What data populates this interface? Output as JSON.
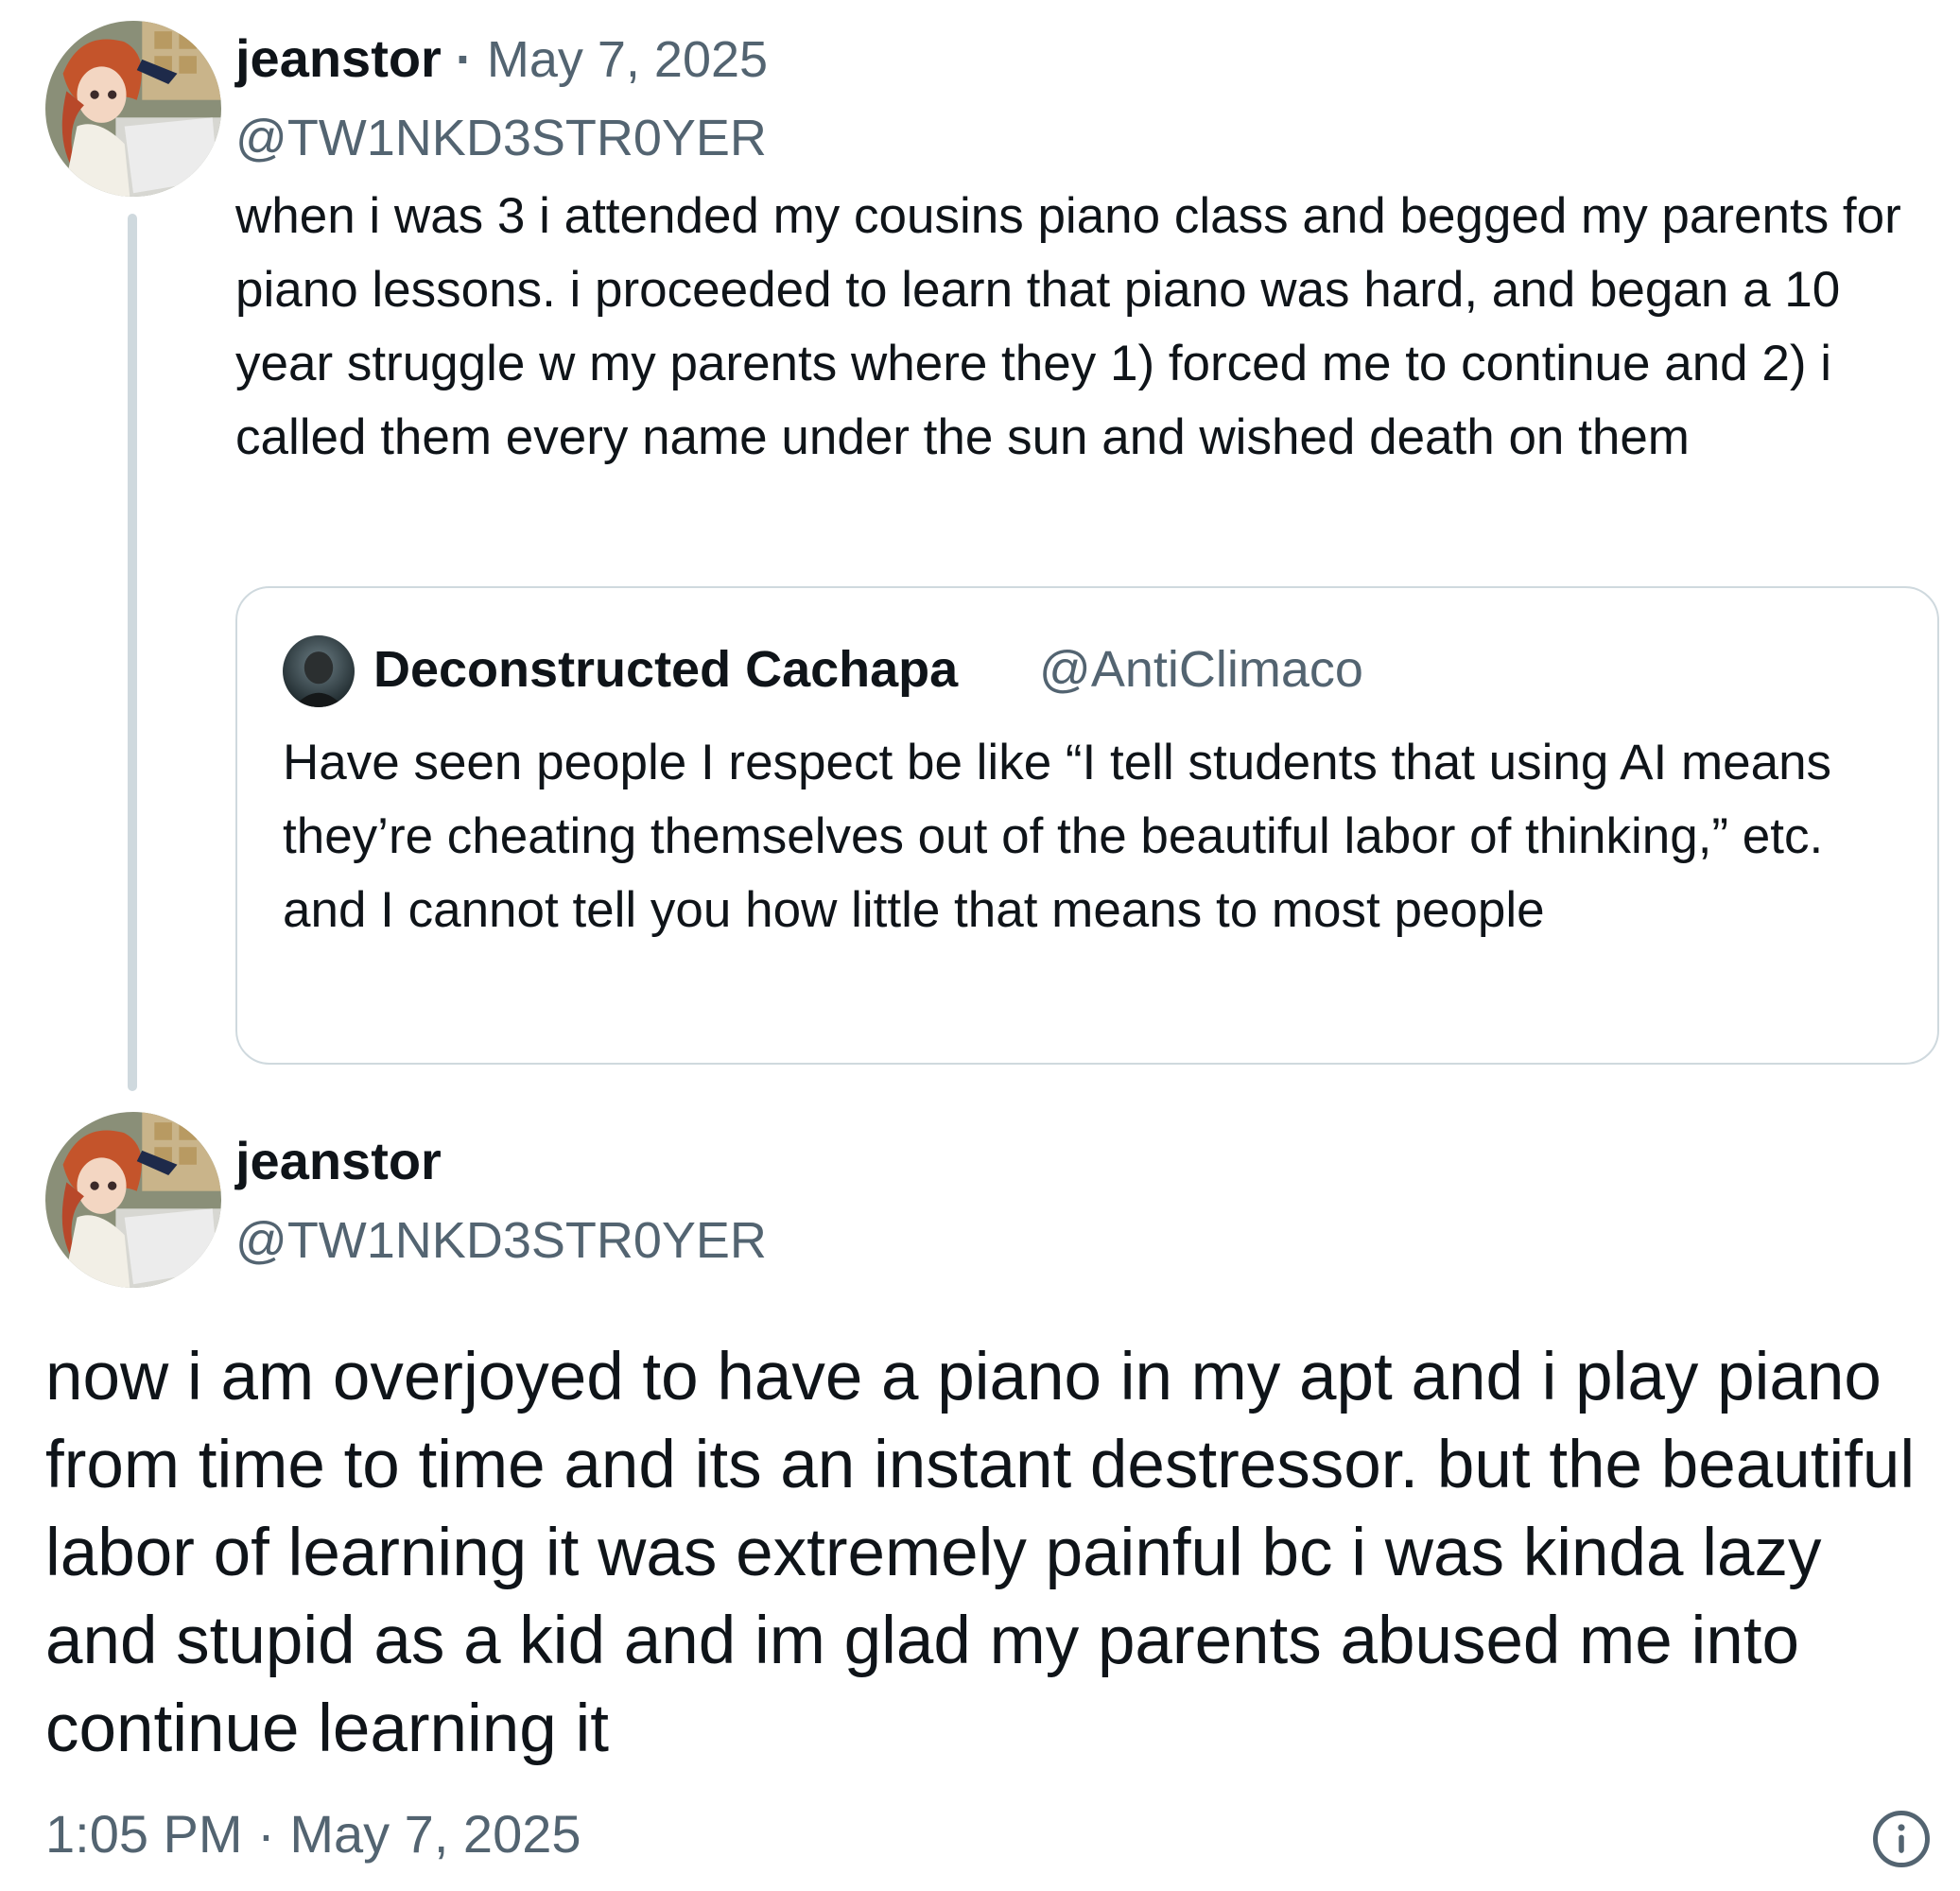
{
  "parent_tweet": {
    "author_name": "jeanstor",
    "date_separator": " · ",
    "date": "May 7, 2025",
    "handle": "@TW1NKD3STR0YER",
    "text": "when i was 3 i attended my cousins piano class and begged my parents for piano lessons. i proceeded to learn that piano was hard, and began a 10 year struggle w my parents where they 1) forced me to continue and 2) i called them every name under the sun and wished death on them",
    "avatar_icon": "anime-character-avatar"
  },
  "quoted_tweet": {
    "author_name": "Deconstructed Cachapa",
    "handle": "@AntiClimaco",
    "text": "Have seen people I respect be like “I tell students that using AI means they’re cheating themselves out of the beautiful labor of thinking,” etc. and I cannot tell you how little that means to most people",
    "avatar_icon": "dark-photo-avatar"
  },
  "main_tweet": {
    "author_name": "jeanstor",
    "handle": "@TW1NKD3STR0YER",
    "text": "now i am overjoyed to have a piano in my apt and i play piano from time to time and its an instant destressor. but the beautiful labor of learning it was extremely painful bc i was kinda lazy and stupid as a kid and im glad my parents abused me into continue learning it",
    "timestamp": "1:05 PM · May 7, 2025",
    "avatar_icon": "anime-character-avatar",
    "info_icon": "info-circle-icon"
  },
  "colors": {
    "text_primary": "#0f1419",
    "text_secondary": "#536471",
    "border": "#cfd9de",
    "background": "#ffffff"
  }
}
